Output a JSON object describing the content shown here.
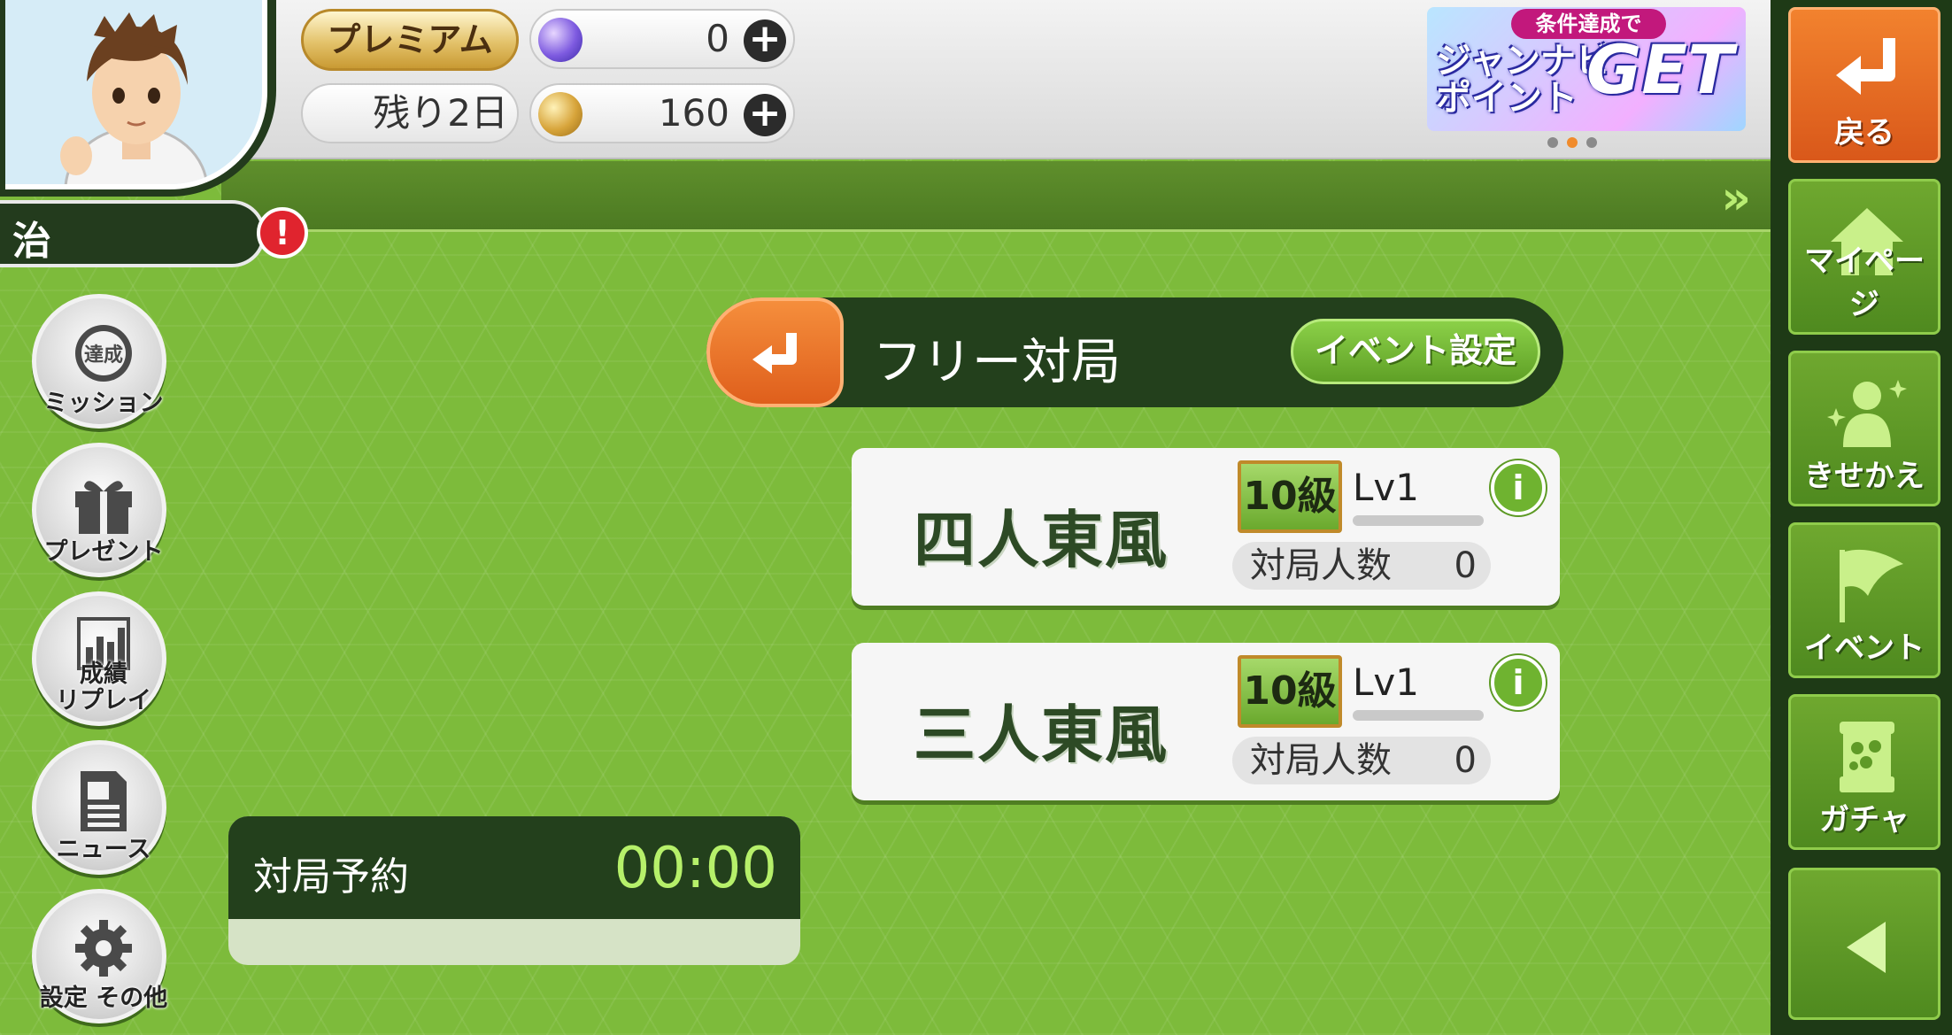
{
  "player": {
    "name": "治",
    "alert_icon": "exclamation-icon"
  },
  "status": {
    "premium_label": "プレミアム",
    "remaining_label": "残り2日",
    "gems": "0",
    "coins": "160"
  },
  "banner": {
    "top": "条件達成で",
    "line1": "ジャンナビ",
    "line2": "ポイント",
    "big": "GET"
  },
  "right_nav": {
    "back": "戻る",
    "mypage": "マイページ",
    "dressup": "きせかえ",
    "event": "イベント",
    "gacha": "ガチャ"
  },
  "left_menu": {
    "mission": "ミッション",
    "mission_stamp": "達成",
    "present": "プレゼント",
    "record_line1": "成績",
    "record_line2": "リプレイ",
    "news": "ニュース",
    "settings": "設定 その他"
  },
  "mode": {
    "title": "フリー対局",
    "event_button": "イベント設定"
  },
  "rooms": [
    {
      "title": "四人東風",
      "rank": "10級",
      "level": "Lv1",
      "players_label": "対局人数",
      "players": "0"
    },
    {
      "title": "三人東風",
      "rank": "10級",
      "level": "Lv1",
      "players_label": "対局人数",
      "players": "0"
    }
  ],
  "reservation": {
    "label": "対局予約",
    "time": "00:00"
  },
  "colors": {
    "field": "#7dbb3b",
    "dark": "#23401c",
    "orange": "#e8712a",
    "accent_green": "#b6f06a"
  }
}
